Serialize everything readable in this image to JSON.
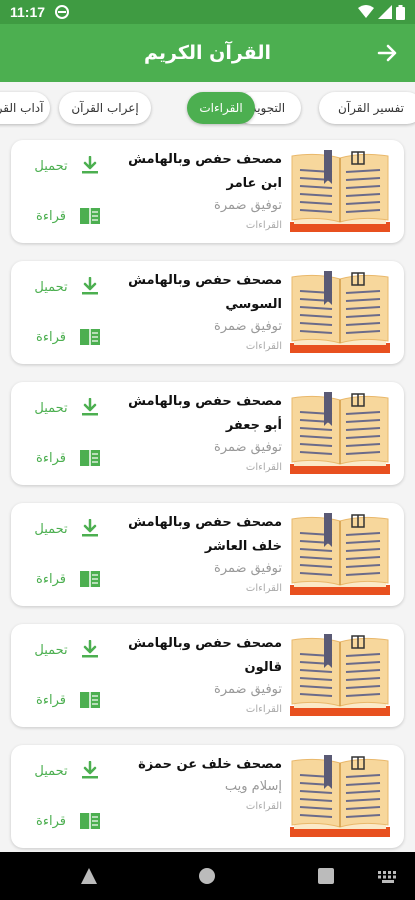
{
  "status_bar": {
    "time": "11:17"
  },
  "app_bar": {
    "title": "القرآن الكريم"
  },
  "tabs": [
    {
      "label": "تفسير القرآن",
      "active": false
    },
    {
      "label": "التجويد",
      "active": false
    },
    {
      "label": "القراءات",
      "active": true
    },
    {
      "label": "إعراب القرآن",
      "active": false
    },
    {
      "label": "آداب القرآن",
      "active": false
    }
  ],
  "cards": [
    {
      "title": "مصحف حفص وبالهامش ابن عامر",
      "author": "توفيق ضمرة",
      "category": "القراءات",
      "download_label": "تحميل",
      "read_label": "قراءة"
    },
    {
      "title": "مصحف حفص وبالهامش السوسي",
      "author": "توفيق ضمرة",
      "category": "القراءات",
      "download_label": "تحميل",
      "read_label": "قراءة"
    },
    {
      "title": "مصحف حفص وبالهامش أبو جعفر",
      "author": "توفيق ضمرة",
      "category": "القراءات",
      "download_label": "تحميل",
      "read_label": "قراءة"
    },
    {
      "title": "مصحف حفص وبالهامش خلف العاشر",
      "author": "توفيق ضمرة",
      "category": "القراءات",
      "download_label": "تحميل",
      "read_label": "قراءة"
    },
    {
      "title": "مصحف حفص وبالهامش قالون",
      "author": "توفيق ضمرة",
      "category": "القراءات",
      "download_label": "تحميل",
      "read_label": "قراءة"
    },
    {
      "title": "مصحف خلف عن حمزة",
      "author": "إسلام ويب",
      "category": "القراءات",
      "download_label": "تحميل",
      "read_label": "قراءة"
    }
  ],
  "colors": {
    "primary": "#4caf50",
    "status_bar": "#3f9b42",
    "book_cover": "#e8501f"
  },
  "icons": [
    "back-arrow-icon",
    "download-icon",
    "open-book-icon",
    "book-illustration-icon"
  ]
}
